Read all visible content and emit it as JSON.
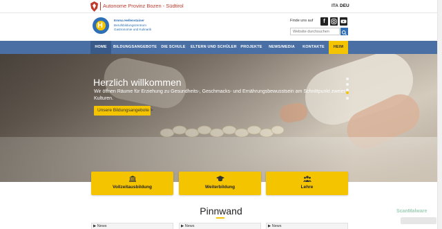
{
  "topbar": {
    "province_label": "Autonome Provinz Bozen - Südtirol",
    "languages": [
      "ITA",
      "DEU"
    ],
    "active_language": "DEU"
  },
  "header": {
    "school_name": "Emma Hellenstainer",
    "school_sub1": "Berufsbildungszentrum",
    "school_sub2": "Gastronomie und Kulinarik",
    "find_us": "Finde uns auf",
    "search_placeholder": "Website durchsuchen"
  },
  "nav": {
    "items": [
      "HOME",
      "BILDUNGSANGEBOTE",
      "DIE SCHULE",
      "ELTERN UND SCHÜLER",
      "PROJEKTE",
      "NEWS/MEDIA",
      "KONTAKTE",
      "HEIM"
    ],
    "active": "HOME"
  },
  "hero": {
    "title": "Herzlich willkommen",
    "text_line1": "Wir öffnen Räume für Erziehung zu Gesundheits-, Geschmacks- und Ernährungsbewusstsein am Schnittpunkt zweier",
    "text_line2": "Kulturen.",
    "button": "Unsere Bildungsangebote >",
    "slides": 5,
    "active_slide": 4
  },
  "cards": [
    {
      "icon": "institution-icon",
      "label": "Vollzeitausbildung"
    },
    {
      "icon": "graduation-cap-icon",
      "label": "Weiterbildung"
    },
    {
      "icon": "users-icon",
      "label": "Lehre"
    }
  ],
  "pinnwand": {
    "title": "Pinnwand",
    "news": [
      "News",
      "News",
      "News"
    ]
  },
  "watermark": "ScanMalware",
  "colors": {
    "nav_blue": "#4a6fa5",
    "accent_yellow": "#f5c400",
    "brand_blue": "#2e6fb5",
    "province_red": "#c0392b"
  }
}
